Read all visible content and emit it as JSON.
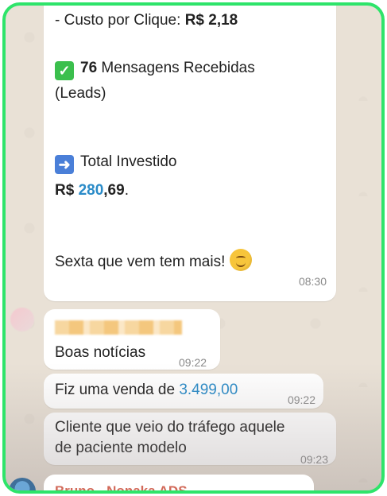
{
  "summary": {
    "cpc_label": "- Custo por Clique:",
    "cpc_value": "R$ 2,18",
    "leads_count": "76",
    "leads_label": "Mensagens Recebidas",
    "leads_label2": "(Leads)",
    "invest_label": "Total Investido",
    "invest_prefix": "R$",
    "invest_int": "280",
    "invest_dec": ",69",
    "invest_dot": ".",
    "closing": "Sexta que vem tem mais!",
    "time": "08:30"
  },
  "messages": [
    {
      "text": "Boas notícias",
      "time": "09:22"
    },
    {
      "text_prefix": "Fiz uma venda de",
      "amount": "3.499,00",
      "time": "09:22"
    },
    {
      "text_line1": "Cliente que veio do tráfego aquele",
      "text_line2": "de paciente modelo",
      "time": "09:23"
    }
  ],
  "next_sender": "Bruno - Nonaka ADS",
  "colors": {
    "frame": "#2ee46a",
    "link_blue": "#2a8bc8",
    "sender_name": "#d26a5a"
  }
}
